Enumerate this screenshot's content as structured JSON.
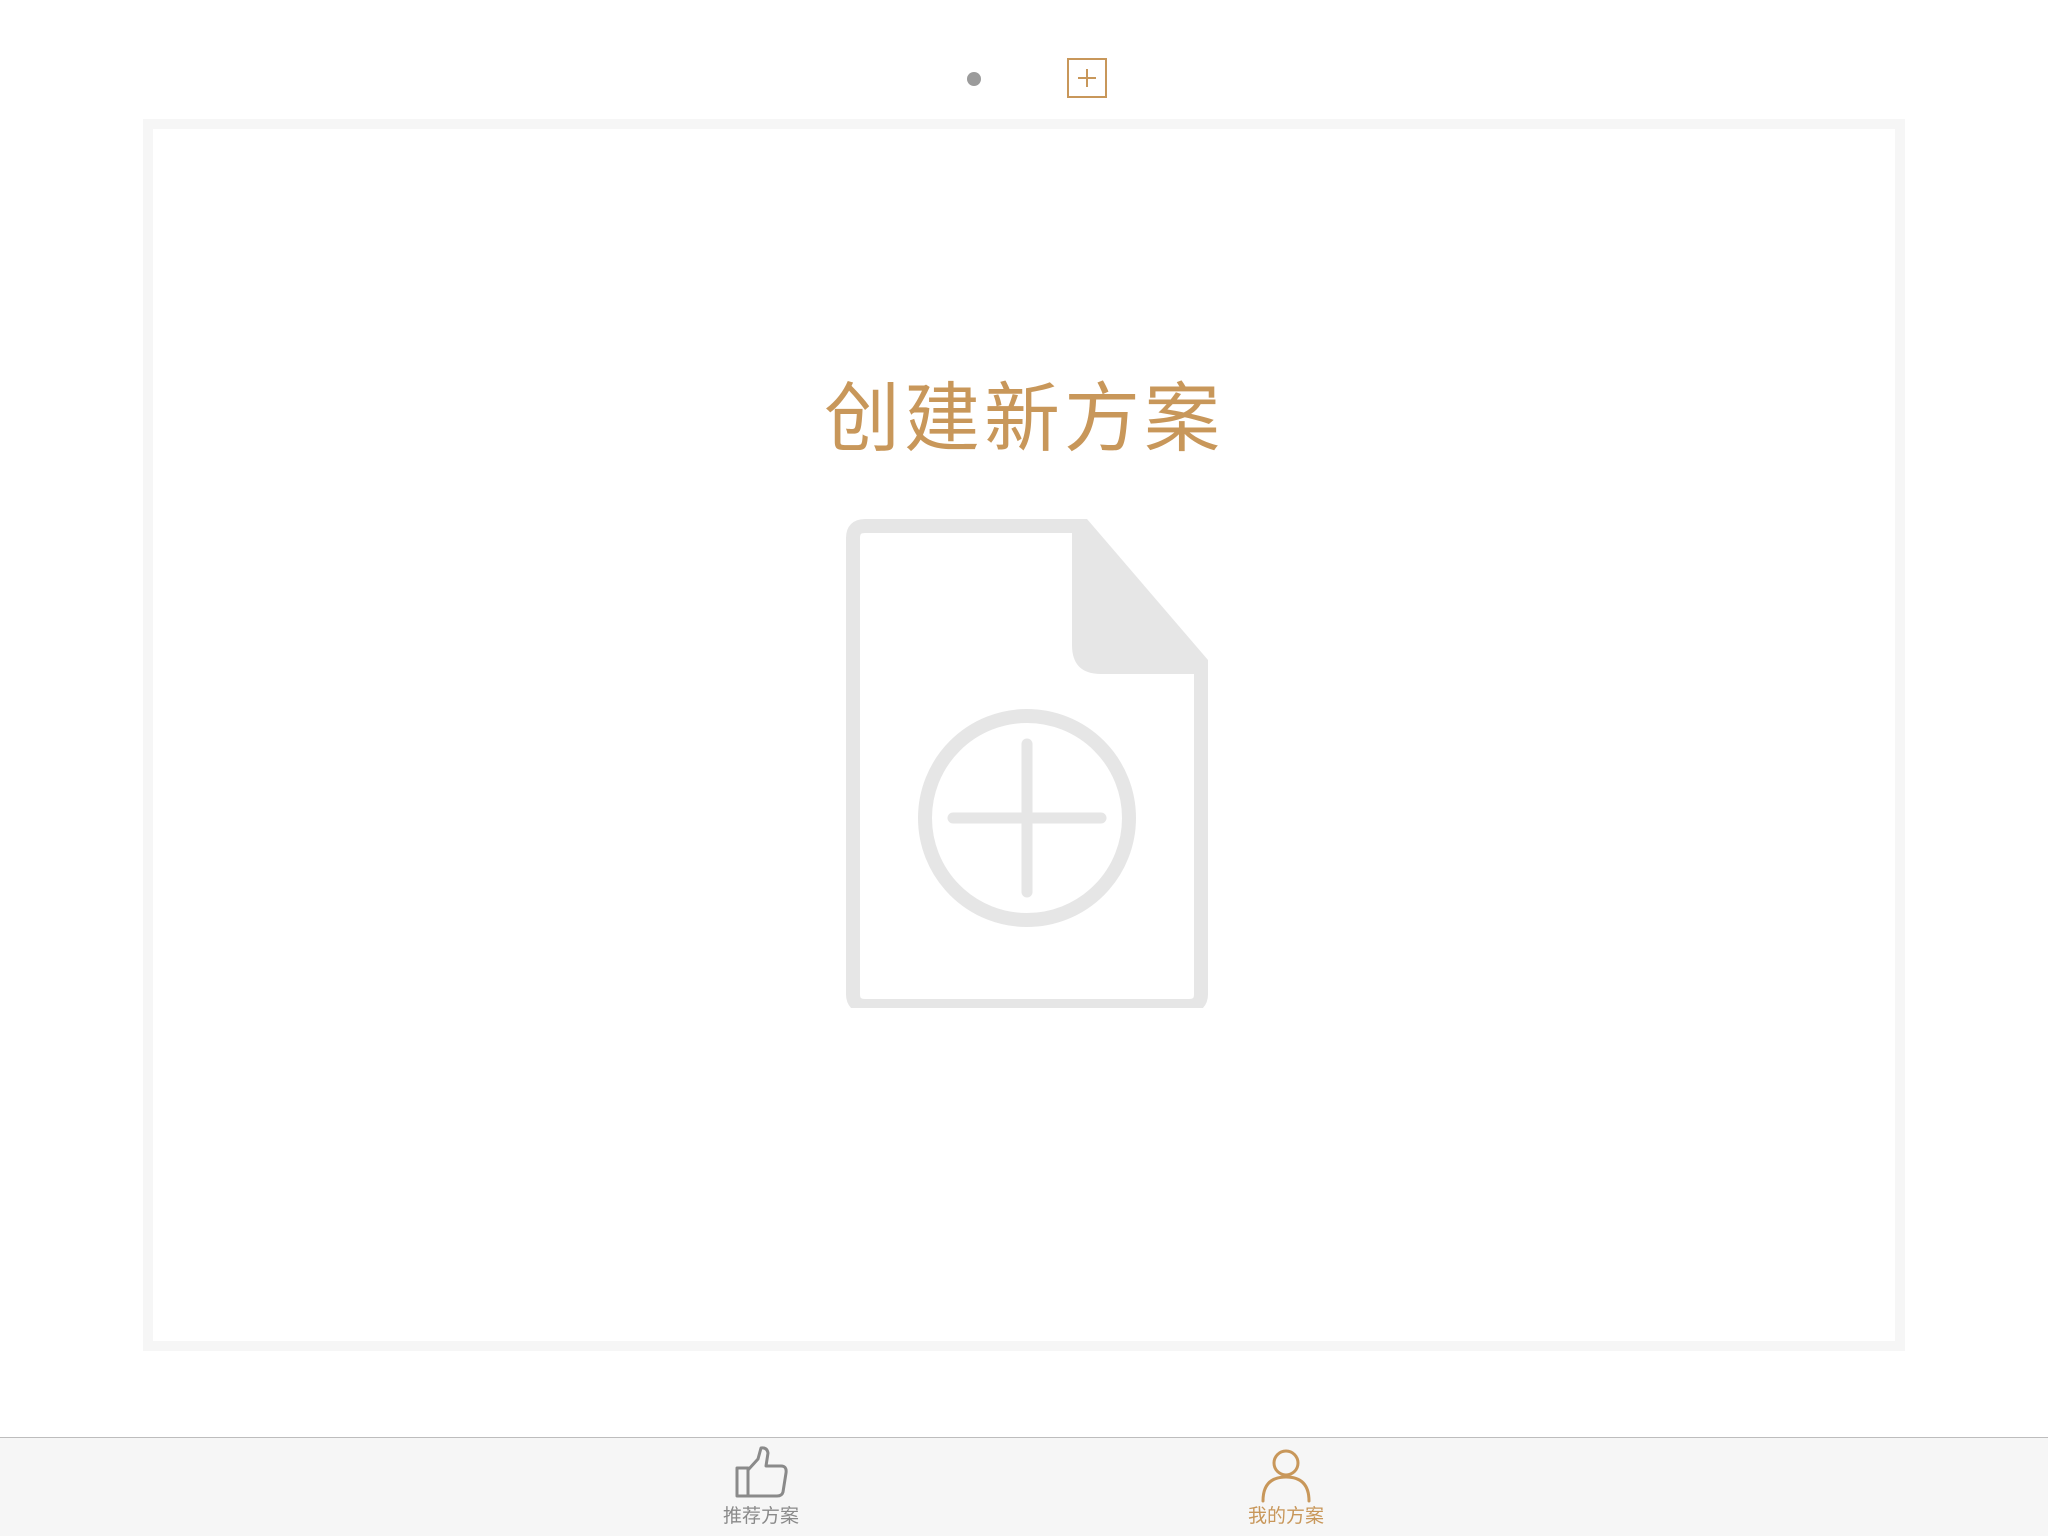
{
  "pager": {
    "dot_icon": "page-dot",
    "add_icon": "plus-square-icon"
  },
  "card": {
    "title": "创建新方案",
    "icon": "document-add-icon"
  },
  "tabbar": {
    "tabs": [
      {
        "label": "推荐方案",
        "icon": "thumbs-up-icon",
        "active": false
      },
      {
        "label": "我的方案",
        "icon": "user-icon",
        "active": true
      }
    ]
  },
  "colors": {
    "accent": "#c8975a",
    "inactive": "#8a8a8a",
    "icon_gray": "#e6e6e6",
    "card_border": "#f6f6f6",
    "tabbar_bg": "#f6f6f6"
  }
}
